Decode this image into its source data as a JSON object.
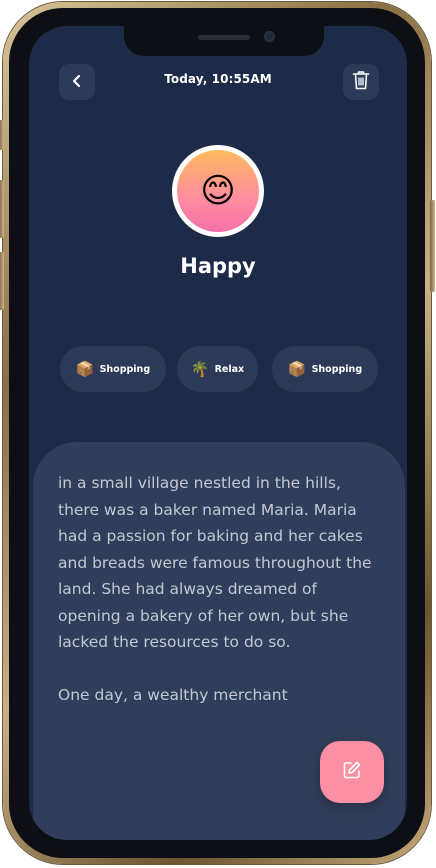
{
  "header": {
    "datetime": "Today, 10:55AM",
    "back_icon": "chevron-left-icon",
    "trash_icon": "trash-icon"
  },
  "mood": {
    "label": "Happy",
    "emoji": "😊",
    "gradient": [
      "#ffb95c",
      "#f470a8"
    ]
  },
  "tags": [
    {
      "emoji": "📦",
      "label": "Shopping"
    },
    {
      "emoji": "🌴",
      "label": "Relax"
    },
    {
      "emoji": "📦",
      "label": "Shopping"
    }
  ],
  "note": {
    "text": "in a small village nestled in the hills, there was a baker named Maria. Maria had a passion for baking and her cakes and breads were famous throughout the land. She had always dreamed of opening a bakery of her own, but she lacked the resources to do so.\n\nOne day, a wealthy merchant"
  },
  "fab": {
    "icon": "edit-icon"
  },
  "colors": {
    "background": "#1e2b48",
    "card": "#313e5b",
    "accent": "#fc8fa1",
    "tag_background": "#2d3a57"
  }
}
